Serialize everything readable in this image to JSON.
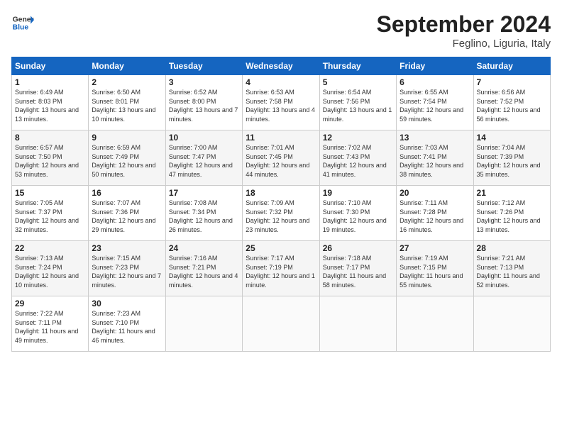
{
  "header": {
    "logo_line1": "General",
    "logo_line2": "Blue",
    "month_title": "September 2024",
    "subtitle": "Feglino, Liguria, Italy"
  },
  "columns": [
    "Sunday",
    "Monday",
    "Tuesday",
    "Wednesday",
    "Thursday",
    "Friday",
    "Saturday"
  ],
  "weeks": [
    [
      {
        "day": "1",
        "sunrise": "Sunrise: 6:49 AM",
        "sunset": "Sunset: 8:03 PM",
        "daylight": "Daylight: 13 hours and 13 minutes."
      },
      {
        "day": "2",
        "sunrise": "Sunrise: 6:50 AM",
        "sunset": "Sunset: 8:01 PM",
        "daylight": "Daylight: 13 hours and 10 minutes."
      },
      {
        "day": "3",
        "sunrise": "Sunrise: 6:52 AM",
        "sunset": "Sunset: 8:00 PM",
        "daylight": "Daylight: 13 hours and 7 minutes."
      },
      {
        "day": "4",
        "sunrise": "Sunrise: 6:53 AM",
        "sunset": "Sunset: 7:58 PM",
        "daylight": "Daylight: 13 hours and 4 minutes."
      },
      {
        "day": "5",
        "sunrise": "Sunrise: 6:54 AM",
        "sunset": "Sunset: 7:56 PM",
        "daylight": "Daylight: 13 hours and 1 minute."
      },
      {
        "day": "6",
        "sunrise": "Sunrise: 6:55 AM",
        "sunset": "Sunset: 7:54 PM",
        "daylight": "Daylight: 12 hours and 59 minutes."
      },
      {
        "day": "7",
        "sunrise": "Sunrise: 6:56 AM",
        "sunset": "Sunset: 7:52 PM",
        "daylight": "Daylight: 12 hours and 56 minutes."
      }
    ],
    [
      {
        "day": "8",
        "sunrise": "Sunrise: 6:57 AM",
        "sunset": "Sunset: 7:50 PM",
        "daylight": "Daylight: 12 hours and 53 minutes."
      },
      {
        "day": "9",
        "sunrise": "Sunrise: 6:59 AM",
        "sunset": "Sunset: 7:49 PM",
        "daylight": "Daylight: 12 hours and 50 minutes."
      },
      {
        "day": "10",
        "sunrise": "Sunrise: 7:00 AM",
        "sunset": "Sunset: 7:47 PM",
        "daylight": "Daylight: 12 hours and 47 minutes."
      },
      {
        "day": "11",
        "sunrise": "Sunrise: 7:01 AM",
        "sunset": "Sunset: 7:45 PM",
        "daylight": "Daylight: 12 hours and 44 minutes."
      },
      {
        "day": "12",
        "sunrise": "Sunrise: 7:02 AM",
        "sunset": "Sunset: 7:43 PM",
        "daylight": "Daylight: 12 hours and 41 minutes."
      },
      {
        "day": "13",
        "sunrise": "Sunrise: 7:03 AM",
        "sunset": "Sunset: 7:41 PM",
        "daylight": "Daylight: 12 hours and 38 minutes."
      },
      {
        "day": "14",
        "sunrise": "Sunrise: 7:04 AM",
        "sunset": "Sunset: 7:39 PM",
        "daylight": "Daylight: 12 hours and 35 minutes."
      }
    ],
    [
      {
        "day": "15",
        "sunrise": "Sunrise: 7:05 AM",
        "sunset": "Sunset: 7:37 PM",
        "daylight": "Daylight: 12 hours and 32 minutes."
      },
      {
        "day": "16",
        "sunrise": "Sunrise: 7:07 AM",
        "sunset": "Sunset: 7:36 PM",
        "daylight": "Daylight: 12 hours and 29 minutes."
      },
      {
        "day": "17",
        "sunrise": "Sunrise: 7:08 AM",
        "sunset": "Sunset: 7:34 PM",
        "daylight": "Daylight: 12 hours and 26 minutes."
      },
      {
        "day": "18",
        "sunrise": "Sunrise: 7:09 AM",
        "sunset": "Sunset: 7:32 PM",
        "daylight": "Daylight: 12 hours and 23 minutes."
      },
      {
        "day": "19",
        "sunrise": "Sunrise: 7:10 AM",
        "sunset": "Sunset: 7:30 PM",
        "daylight": "Daylight: 12 hours and 19 minutes."
      },
      {
        "day": "20",
        "sunrise": "Sunrise: 7:11 AM",
        "sunset": "Sunset: 7:28 PM",
        "daylight": "Daylight: 12 hours and 16 minutes."
      },
      {
        "day": "21",
        "sunrise": "Sunrise: 7:12 AM",
        "sunset": "Sunset: 7:26 PM",
        "daylight": "Daylight: 12 hours and 13 minutes."
      }
    ],
    [
      {
        "day": "22",
        "sunrise": "Sunrise: 7:13 AM",
        "sunset": "Sunset: 7:24 PM",
        "daylight": "Daylight: 12 hours and 10 minutes."
      },
      {
        "day": "23",
        "sunrise": "Sunrise: 7:15 AM",
        "sunset": "Sunset: 7:23 PM",
        "daylight": "Daylight: 12 hours and 7 minutes."
      },
      {
        "day": "24",
        "sunrise": "Sunrise: 7:16 AM",
        "sunset": "Sunset: 7:21 PM",
        "daylight": "Daylight: 12 hours and 4 minutes."
      },
      {
        "day": "25",
        "sunrise": "Sunrise: 7:17 AM",
        "sunset": "Sunset: 7:19 PM",
        "daylight": "Daylight: 12 hours and 1 minute."
      },
      {
        "day": "26",
        "sunrise": "Sunrise: 7:18 AM",
        "sunset": "Sunset: 7:17 PM",
        "daylight": "Daylight: 11 hours and 58 minutes."
      },
      {
        "day": "27",
        "sunrise": "Sunrise: 7:19 AM",
        "sunset": "Sunset: 7:15 PM",
        "daylight": "Daylight: 11 hours and 55 minutes."
      },
      {
        "day": "28",
        "sunrise": "Sunrise: 7:21 AM",
        "sunset": "Sunset: 7:13 PM",
        "daylight": "Daylight: 11 hours and 52 minutes."
      }
    ],
    [
      {
        "day": "29",
        "sunrise": "Sunrise: 7:22 AM",
        "sunset": "Sunset: 7:11 PM",
        "daylight": "Daylight: 11 hours and 49 minutes."
      },
      {
        "day": "30",
        "sunrise": "Sunrise: 7:23 AM",
        "sunset": "Sunset: 7:10 PM",
        "daylight": "Daylight: 11 hours and 46 minutes."
      },
      null,
      null,
      null,
      null,
      null
    ]
  ]
}
